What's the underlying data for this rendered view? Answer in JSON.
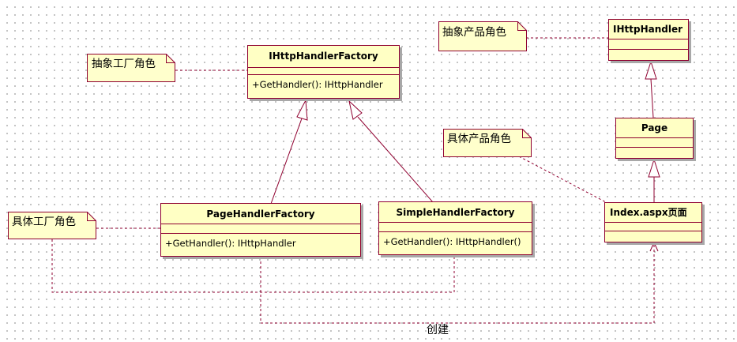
{
  "classes": {
    "ihttphandlerfactory": {
      "name": "IHttpHandlerFactory",
      "operation": "+GetHandler(): IHttpHandler"
    },
    "pagehandlerfactory": {
      "name": "PageHandlerFactory",
      "operation": "+GetHandler(): IHttpHandler"
    },
    "simplehandlerfactory": {
      "name": "SimpleHandlerFactory",
      "operation": "+GetHandler(): IHttpHandler()"
    },
    "ihttphandler": {
      "name": "IHttpHandler",
      "operation": ""
    },
    "page": {
      "name": "Page",
      "operation": ""
    },
    "index": {
      "name": "Index.aspx页面",
      "operation": ""
    }
  },
  "notes": {
    "abstract_factory": "抽象工厂角色",
    "concrete_factory": "具体工厂角色",
    "abstract_product": "抽象产品角色",
    "concrete_product": "具体产品角色"
  },
  "relations": {
    "create_label": "创建"
  },
  "colors": {
    "class_fill": "#ffffc4",
    "class_border": "#8f0030",
    "note_fill": "#ffffcc",
    "shadow": "#a8a8a8"
  }
}
